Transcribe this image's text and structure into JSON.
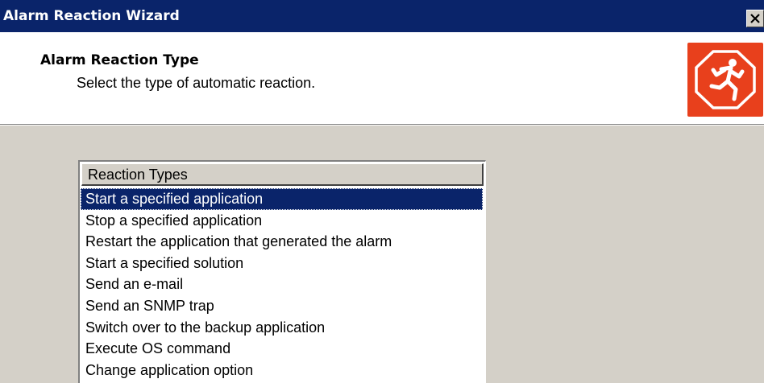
{
  "window": {
    "title": "Alarm Reaction Wizard",
    "close_label": "close"
  },
  "header": {
    "heading": "Alarm Reaction Type",
    "subheading": "Select the type of automatic reaction.",
    "logo_icon": "stop-sign-running-man-icon",
    "logo_color": "#e8401c"
  },
  "list": {
    "column_header": "Reaction Types",
    "selected_index": 0,
    "items": [
      "Start a specified application",
      "Stop a specified application",
      "Restart the application that generated the alarm",
      "Start a specified solution",
      "Send an e-mail",
      "Send an SNMP trap",
      "Switch over to the backup application",
      "Execute OS command",
      "Change application option"
    ]
  },
  "colors": {
    "titlebar": "#0a246a",
    "selection": "#0a246a",
    "dialog_face": "#d4d0c8"
  }
}
